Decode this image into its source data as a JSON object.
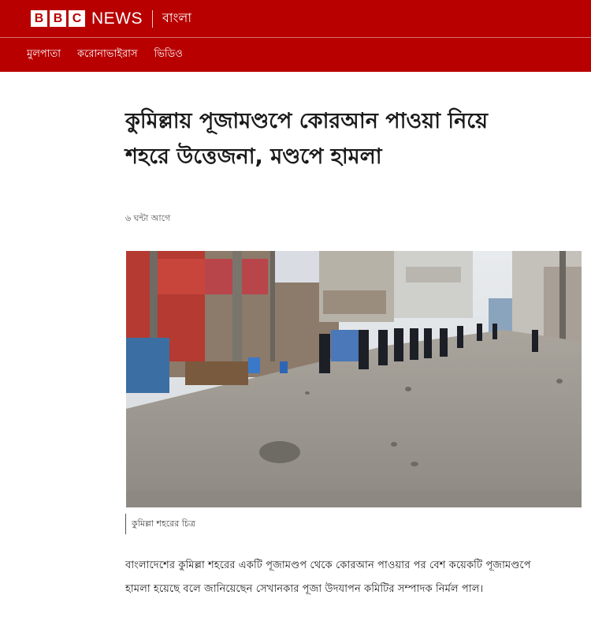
{
  "masthead": {
    "logo_letters": [
      "B",
      "B",
      "C"
    ],
    "news_label": "NEWS",
    "language_label": "বাংলা",
    "brand_color": "#b80000"
  },
  "nav": {
    "items": [
      {
        "label": "মুলপাতা"
      },
      {
        "label": "করোনাভাইরাস"
      },
      {
        "label": "ভিডিও"
      }
    ]
  },
  "article": {
    "headline_line1": "কুমিল্লায় পূজামণ্ডপে কোরআন পাওয়া নিয়ে",
    "headline_line2": "শহরে উত্তেজনা, মণ্ডপে হামলা",
    "timestamp": "৬ ঘন্টা আগে",
    "image_caption": "কুমিল্লা শহরের চিত্র",
    "paragraph": "বাংলাদেশের কুমিল্লা শহরের একটি পূজামণ্ডপ থেকে কোরআন পাওয়ার পর বেশ কয়েকটি পূজামণ্ডপে হামলা হয়েছে বলে জানিয়েছেন সেখানকার পূজা উদযাপন কমিটির সম্পাদক নির্মল পাল।"
  }
}
